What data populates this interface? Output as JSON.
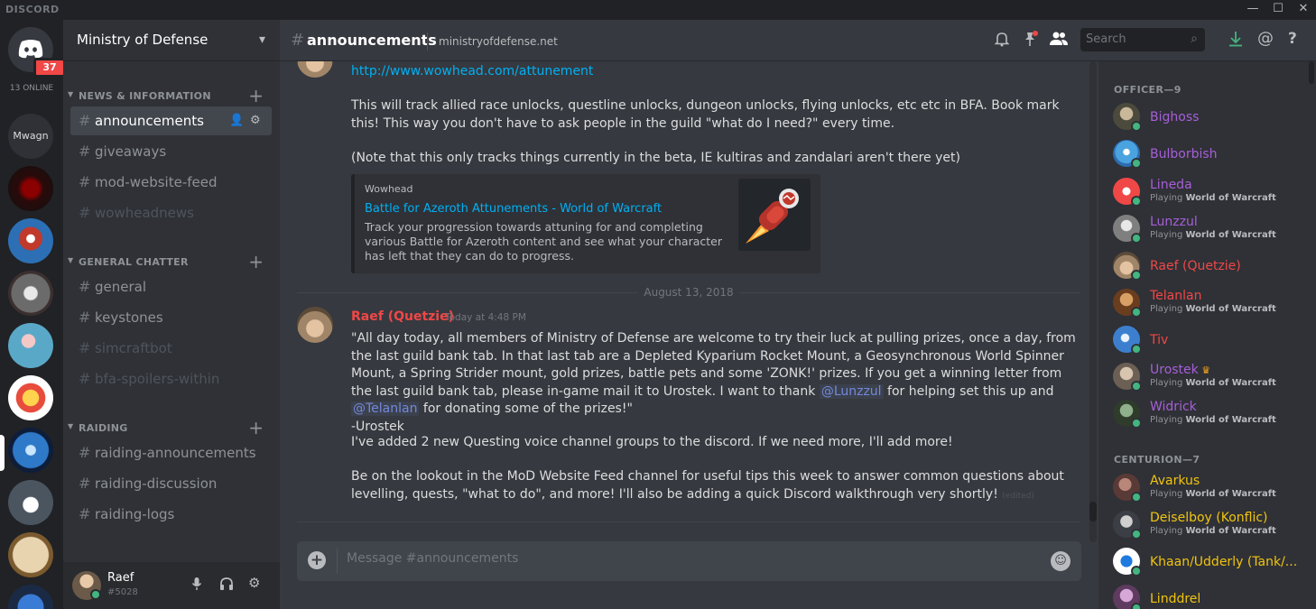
{
  "window": {
    "brand": "DISCORD",
    "controls": [
      "—",
      "☐",
      "✕"
    ]
  },
  "guilds": {
    "home_badge": "37",
    "online_count": "13 ONLINE",
    "text_guild": "Mwagn"
  },
  "server": {
    "name": "Ministry of Defense"
  },
  "categories": [
    {
      "label": "NEWS & INFORMATION",
      "channels": [
        "announcements",
        "giveaways",
        "mod-website-feed",
        "wowheadnews"
      ]
    },
    {
      "label": "GENERAL CHATTER",
      "channels": [
        "general",
        "keystones",
        "simcraftbot",
        "bfa-spoilers-within"
      ]
    },
    {
      "label": "RAIDING",
      "channels": [
        "raiding-announcements",
        "raiding-discussion",
        "raiding-logs"
      ]
    }
  ],
  "user": {
    "name": "Raef",
    "tag": "#5028"
  },
  "header": {
    "channel": "announcements",
    "topic": "ministryofdefense.net",
    "search_placeholder": "Search"
  },
  "messages": {
    "link": "http://www.wowhead.com/attunement",
    "p1": "This will track allied race unlocks, questline unlocks, dungeon unlocks, flying unlocks, etc etc in BFA. Book mark this! This way you don't have to ask people in the guild \"what do I need?\" every time.",
    "p2": "(Note that this only tracks things currently in the beta, IE kultiras and zandalari aren't there yet)",
    "embed": {
      "provider": "Wowhead",
      "title": "Battle for Azeroth Attunements - World of Warcraft",
      "description": "Track your progression towards attuning for and completing various Battle for Azeroth content and see what your character has left that they can do to progress."
    },
    "date_divider": "August 13, 2018",
    "author": "Raef (Quetzie)",
    "timestamp": "Today at 4:48 PM",
    "m1_a": "\"All day today, all members of Ministry of Defense are welcome to try their luck at pulling prizes, once a day, from the last guild bank tab. In that last tab are a Depleted Kyparium Rocket Mount, a Geosynchronous World Spinner Mount, a Spring Strider mount, gold prizes, battle pets and some 'ZONK!' prizes. If you get a winning letter from the last guild bank tab, please in-game mail it to Urostek. I want to thank ",
    "mention1": "@Lunzzul",
    "m1_b": " for helping set this up and ",
    "mention2": "@Telanlan",
    "m1_c": " for donating some of the prizes!\"",
    "m1_sig": "-Urostek",
    "m2": "I've added 2 new Questing voice channel groups to the discord. If we need more, I'll add more!",
    "m3": "Be on the lookout  in the MoD Website Feed channel for useful tips this week to answer common questions about levelling, quests, \"what to do\", and more! I'll also be adding a quick Discord walkthrough very shortly!",
    "edited": "(edited)"
  },
  "composer": {
    "placeholder": "Message #announcements"
  },
  "members": {
    "officer_header": "OFFICER—9",
    "centurion_header": "CENTURION—7",
    "playing_prefix": "Playing ",
    "game": "World of Warcraft",
    "officers": [
      {
        "name": "Bighoss",
        "color": "#a75fd8",
        "playing": false
      },
      {
        "name": "Bulborbish",
        "color": "#a75fd8",
        "playing": false
      },
      {
        "name": "Lineda",
        "color": "#a75fd8",
        "playing": true
      },
      {
        "name": "Lunzzul",
        "color": "#a75fd8",
        "playing": true
      },
      {
        "name": "Raef (Quetzie)",
        "color": "#f04747",
        "playing": false
      },
      {
        "name": "Telanlan",
        "color": "#f04747",
        "playing": true
      },
      {
        "name": "Tiv",
        "color": "#f04747",
        "playing": false
      },
      {
        "name": "Urostek",
        "color": "#a75fd8",
        "playing": true,
        "crown": true
      },
      {
        "name": "Widrick",
        "color": "#a75fd8",
        "playing": true
      }
    ],
    "centurions": [
      {
        "name": "Avarkus",
        "color": "#f1c40f",
        "playing": true
      },
      {
        "name": "Deiselboy (Konflic)",
        "color": "#f1c40f",
        "playing": true
      },
      {
        "name": "Khaan/Udderly (Tank/...",
        "color": "#f1c40f",
        "playing": false
      },
      {
        "name": "Linddrel",
        "color": "#f1c40f",
        "playing": false
      }
    ]
  },
  "colors": {
    "accent": "#7289da",
    "online": "#43b581",
    "mention_badge": "#f04747",
    "link": "#00b0f4"
  }
}
